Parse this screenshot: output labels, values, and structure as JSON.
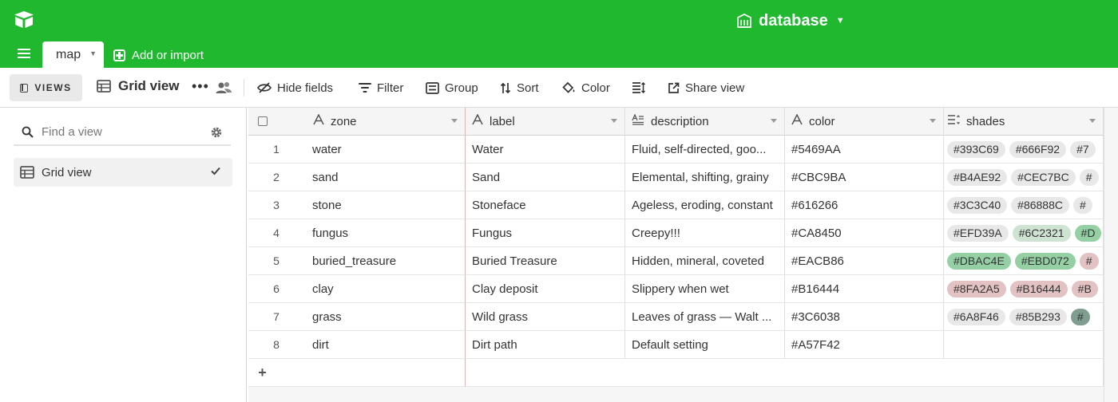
{
  "topbar": {
    "base_title": "database",
    "tab_label": "map",
    "add_import_label": "Add or import"
  },
  "toolbar": {
    "views_label": "VIEWS",
    "view_name": "Grid view",
    "items": [
      {
        "label": "Hide fields",
        "icon": "hide-fields-icon"
      },
      {
        "label": "Filter",
        "icon": "filter-icon"
      },
      {
        "label": "Group",
        "icon": "group-icon"
      },
      {
        "label": "Sort",
        "icon": "sort-icon"
      },
      {
        "label": "Color",
        "icon": "paint-bucket-icon"
      },
      {
        "label": "",
        "icon": "row-height-icon"
      },
      {
        "label": "Share view",
        "icon": "share-icon"
      }
    ]
  },
  "sidebar": {
    "search_placeholder": "Find a view",
    "views": [
      {
        "label": "Grid view",
        "selected": true
      }
    ]
  },
  "grid": {
    "columns": [
      {
        "name": "zone",
        "type_icon": "text-field-icon"
      },
      {
        "name": "label",
        "type_icon": "text-field-icon"
      },
      {
        "name": "description",
        "type_icon": "long-text-field-icon"
      },
      {
        "name": "color",
        "type_icon": "text-field-icon"
      },
      {
        "name": "shades",
        "type_icon": "multi-select-field-icon"
      }
    ],
    "rows": [
      {
        "num": "1",
        "zone": "water",
        "label": "Water",
        "description": "Fluid, self-directed, goo...",
        "color": "#5469AA",
        "shades": [
          {
            "text": "#393C69",
            "bg": "#e8e8e8"
          },
          {
            "text": "#666F92",
            "bg": "#e8e8e8"
          },
          {
            "text": "#7",
            "bg": "#e8e8e8"
          }
        ]
      },
      {
        "num": "2",
        "zone": "sand",
        "label": "Sand",
        "description": "Elemental, shifting, grainy",
        "color": "#CBC9BA",
        "shades": [
          {
            "text": "#B4AE92",
            "bg": "#e8e8e8"
          },
          {
            "text": "#CEC7BC",
            "bg": "#e8e8e8"
          },
          {
            "text": "#",
            "bg": "#e8e8e8"
          }
        ]
      },
      {
        "num": "3",
        "zone": "stone",
        "label": "Stoneface",
        "description": "Ageless, eroding, constant",
        "color": "#616266",
        "shades": [
          {
            "text": "#3C3C40",
            "bg": "#e8e8e8"
          },
          {
            "text": "#86888C",
            "bg": "#e8e8e8"
          },
          {
            "text": "#",
            "bg": "#e8e8e8"
          }
        ]
      },
      {
        "num": "4",
        "zone": "fungus",
        "label": "Fungus",
        "description": "Creepy!!!",
        "color": "#CA8450",
        "shades": [
          {
            "text": "#EFD39A",
            "bg": "#e8e8e8"
          },
          {
            "text": "#6C2321",
            "bg": "#cfe3d3"
          },
          {
            "text": "#D",
            "bg": "#94d0a4"
          }
        ]
      },
      {
        "num": "5",
        "zone": "buried_treasure",
        "label": "Buried Treasure",
        "description": "Hidden, mineral, coveted",
        "color": "#EACB86",
        "shades": [
          {
            "text": "#DBAC4E",
            "bg": "#94d0a4"
          },
          {
            "text": "#EBD072",
            "bg": "#94d0a4"
          },
          {
            "text": "#",
            "bg": "#e2c2c2"
          }
        ]
      },
      {
        "num": "6",
        "zone": "clay",
        "label": "Clay deposit",
        "description": "Slippery when wet",
        "color": "#B16444",
        "shades": [
          {
            "text": "#8FA2A5",
            "bg": "#e2c2c2"
          },
          {
            "text": "#B16444",
            "bg": "#e2c2c2"
          },
          {
            "text": "#B",
            "bg": "#e2c2c2"
          }
        ]
      },
      {
        "num": "7",
        "zone": "grass",
        "label": "Wild grass",
        "description": "Leaves of grass — Walt ...",
        "color": "#3C6038",
        "shades": [
          {
            "text": "#6A8F46",
            "bg": "#e8e8e8"
          },
          {
            "text": "#85B293",
            "bg": "#e8e8e8"
          },
          {
            "text": "#",
            "bg": "#7f9e90"
          }
        ]
      },
      {
        "num": "8",
        "zone": "dirt",
        "label": "Dirt path",
        "description": "Default setting",
        "color": "#A57F42",
        "shades": []
      }
    ],
    "add_row_symbol": "+"
  }
}
